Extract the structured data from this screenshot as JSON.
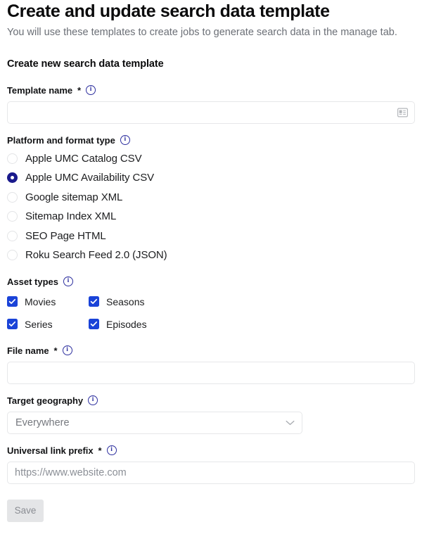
{
  "header": {
    "title": "Create and update search data template",
    "subtitle": "You will use these templates to create jobs to generate search data in the manage tab."
  },
  "form": {
    "section_title": "Create new search data template",
    "template_name": {
      "label": "Template name",
      "required_marker": "*",
      "value": "",
      "placeholder": "",
      "trailing_icon": "contact-card-icon",
      "info_icon": "info-icon"
    },
    "platform_format": {
      "label": "Platform and format type",
      "info_icon": "info-icon",
      "options": [
        {
          "label": "Apple UMC Catalog CSV",
          "selected": false
        },
        {
          "label": "Apple UMC Availability CSV",
          "selected": true
        },
        {
          "label": "Google sitemap XML",
          "selected": false
        },
        {
          "label": "Sitemap Index XML",
          "selected": false
        },
        {
          "label": "SEO Page HTML",
          "selected": false
        },
        {
          "label": "Roku Search Feed 2.0 (JSON)",
          "selected": false
        }
      ]
    },
    "asset_types": {
      "label": "Asset types",
      "info_icon": "info-icon",
      "options": [
        {
          "label": "Movies",
          "checked": true
        },
        {
          "label": "Seasons",
          "checked": true
        },
        {
          "label": "Series",
          "checked": true
        },
        {
          "label": "Episodes",
          "checked": true
        }
      ]
    },
    "file_name": {
      "label": "File name",
      "required_marker": "*",
      "value": "",
      "placeholder": "",
      "info_icon": "info-icon"
    },
    "target_geography": {
      "label": "Target geography",
      "info_icon": "info-icon",
      "selected_value": "Everywhere",
      "chevron_icon": "chevron-down-icon"
    },
    "universal_link_prefix": {
      "label": "Universal link prefix",
      "required_marker": "*",
      "value": "",
      "placeholder": "https://www.website.com",
      "info_icon": "info-icon"
    },
    "save_button": {
      "label": "Save",
      "disabled": true
    }
  },
  "colors": {
    "accent_checkbox": "#1a43d8",
    "accent_radio_selected": "#1a1a8c",
    "info_icon": "#2c2e9e",
    "text_primary": "#0b0b0c",
    "text_muted": "#6b6f76",
    "border": "#e6e7e9",
    "disabled_button_bg": "#e4e5e7"
  }
}
